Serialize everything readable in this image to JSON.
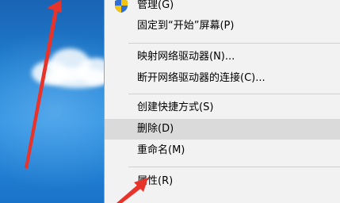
{
  "context_menu": {
    "items": [
      {
        "label": "管理(G)",
        "icon": "uac-shield-icon"
      },
      {
        "label": "固定到“开始”屏幕(P)"
      },
      {
        "label": "映射网络驱动器(N)..."
      },
      {
        "label": "断开网络驱动器的连接(C)..."
      },
      {
        "label": "创建快捷方式(S)"
      },
      {
        "label": "删除(D)",
        "highlighted": true
      },
      {
        "label": "重命名(M)"
      },
      {
        "label": "属性(R)"
      }
    ]
  },
  "colors": {
    "menu_background": "#f2f2f2",
    "highlight": "#dadada",
    "arrow": "#e8332a",
    "desktop_blue": "#1f7fd0"
  }
}
